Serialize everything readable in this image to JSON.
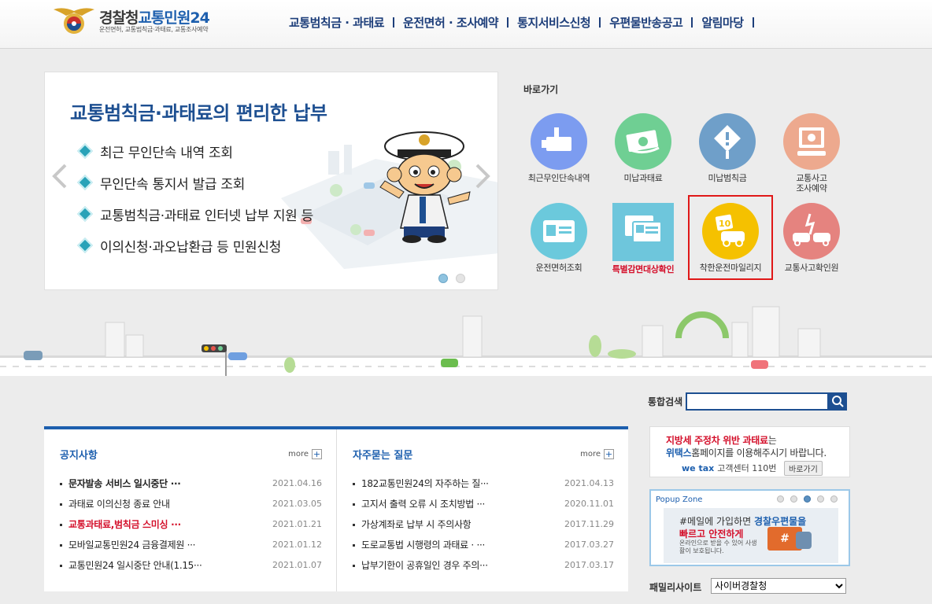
{
  "header": {
    "logo_title_gray": "경찰청",
    "logo_title_blue": "교통민원24",
    "logo_sub": "운전면허, 교통범칙금·과태료, 교통조사예약",
    "nav": [
      "교통범칙금 · 과태료",
      "운전면허 · 조사예약",
      "통지서비스신청",
      "우편물반송공고",
      "알림마당"
    ]
  },
  "slider": {
    "title": "교통범칙금·과태료의 편리한 납부",
    "items": [
      "최근 무인단속 내역 조회",
      "무인단속 통지서 발급 조회",
      "교통범칙금·과태료 인터넷 납부 지원 등",
      "이의신청·과오납환급 등 민원신청"
    ],
    "slide_count": 2,
    "active_slide": 1
  },
  "quick": {
    "title": "바로가기",
    "items": [
      {
        "label": "최근무인단속내역",
        "icon": "camera-icon",
        "color": "#7c9cf0"
      },
      {
        "label": "미납과태료",
        "icon": "money-icon",
        "color": "#6fcf93"
      },
      {
        "label": "미납범칙금",
        "icon": "warning-sign-icon",
        "color": "#6f9fc9"
      },
      {
        "label": "교통사고\n조사예약",
        "icon": "monitor-icon",
        "color": "#eda98e"
      },
      {
        "label": "운전면허조회",
        "icon": "license-card-icon",
        "color": "#6bc9dc"
      },
      {
        "label": "특별감면대상확인",
        "icon": "computer-icon",
        "color": "#6ec6dc",
        "red": true
      },
      {
        "label": "착한운전마일리지",
        "icon": "mileage-car-icon",
        "color": "#f5c100"
      },
      {
        "label": "교통사고확인원",
        "icon": "car-crash-icon",
        "color": "#e5837f"
      }
    ]
  },
  "search": {
    "label": "통합검색",
    "placeholder": ""
  },
  "notice": {
    "title": "공지사항",
    "more": "more",
    "rows": [
      {
        "title": "문자발송 서비스 일시중단 ···",
        "date": "2021.04.16",
        "emph": "bold"
      },
      {
        "title": "과태료 이의신청 종료 안내",
        "date": "2021.03.05"
      },
      {
        "title": "교통과태료,범칙금 스미싱 ···",
        "date": "2021.01.21",
        "emph": "red"
      },
      {
        "title": "모바일교통민원24 금융결제원 ···",
        "date": "2021.01.12"
      },
      {
        "title": "교통민원24 일시중단 안내(1.15···",
        "date": "2021.01.07"
      }
    ]
  },
  "faq": {
    "title": "자주묻는 질문",
    "more": "more",
    "rows": [
      {
        "title": "182교통민원24의 자주하는 질···",
        "date": "2021.04.13"
      },
      {
        "title": "고지서 출력 오류 시 조치방법 ···",
        "date": "2020.11.01"
      },
      {
        "title": "가상계좌로 납부 시 주의사항",
        "date": "2017.11.29"
      },
      {
        "title": "도로교통법 시행령의 과태료 · ···",
        "date": "2017.03.27"
      },
      {
        "title": "납부기한이 공휴일인 경우 주의···",
        "date": "2017.03.17"
      }
    ]
  },
  "banner": {
    "line1_red": "지방세 주정차 위반 과태료",
    "line1_rest": "는",
    "line2_blue": "위택스",
    "line2_rest": "홈페이지를 이용해주시기 바랍니다.",
    "wetax": "we tax",
    "callcenter": "고객센터 110번",
    "button": "바로가기"
  },
  "popup": {
    "title": "Popup Zone",
    "line1_a": "#메일에 가입하면 ",
    "line1_b": "경찰우편물을",
    "line2": "빠르고 안전하게",
    "line3": "온라인으로 받을 수 있어 사생활이 보호됩니다.",
    "mail_icon_text": "#",
    "dot_count": 5,
    "active_dot": 3
  },
  "family": {
    "label": "패밀리사이트",
    "selected": "사이버경찰청"
  },
  "colors": {
    "brand_blue": "#1d5fae",
    "highlight_red": "#e01818",
    "emphasis_red": "#d4102b"
  }
}
